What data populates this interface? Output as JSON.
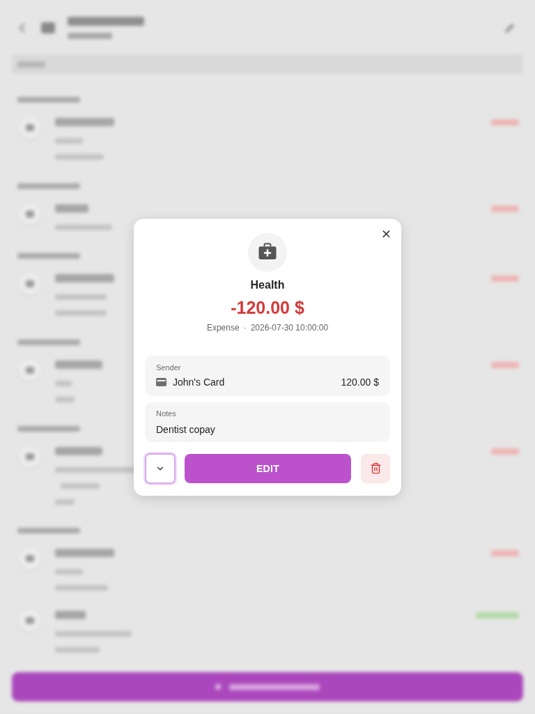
{
  "dialog": {
    "kind": "expense",
    "category": "Health",
    "amount": "-120.00 $",
    "type": "Expense",
    "separator": "·",
    "datetime": "2026-07-30 10:00:00",
    "sender": {
      "label": "Sender",
      "account": "John's Card",
      "amount": "120.00 $"
    },
    "notes": {
      "label": "Notes",
      "value": "Dentist copay"
    },
    "actions": {
      "expand": {
        "expanded": false,
        "focused": true
      },
      "edit": "EDIT"
    }
  }
}
